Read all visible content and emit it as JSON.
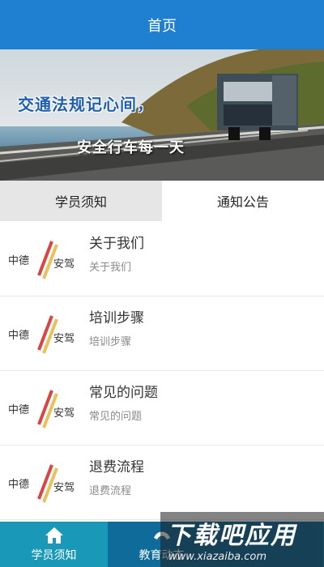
{
  "header": {
    "title": "首页"
  },
  "banner": {
    "slogan1": "交通法规记心间，",
    "slogan2": "安全行车每一天"
  },
  "tabs": [
    {
      "label": "学员须知",
      "active": true
    },
    {
      "label": "通知公告",
      "active": false
    }
  ],
  "list": [
    {
      "title": "关于我们",
      "subtitle": "关于我们"
    },
    {
      "title": "培训步骤",
      "subtitle": "培训步骤"
    },
    {
      "title": "常见的问题",
      "subtitle": "常见的问题"
    },
    {
      "title": "退费流程",
      "subtitle": "退费流程"
    }
  ],
  "logo": {
    "text_left": "中德",
    "text_right": "安驾"
  },
  "bottom_nav": [
    {
      "label": "学员须知",
      "icon": "home-icon"
    },
    {
      "label": "教育动态",
      "icon": "education-icon"
    }
  ],
  "watermark": {
    "line1": "下载吧应用",
    "line2": "www.xiazaiba.com"
  },
  "colors": {
    "header": "#1f7fd0",
    "bottom_bar": "#1a98b8",
    "tab_active": "#e6e6e6"
  }
}
